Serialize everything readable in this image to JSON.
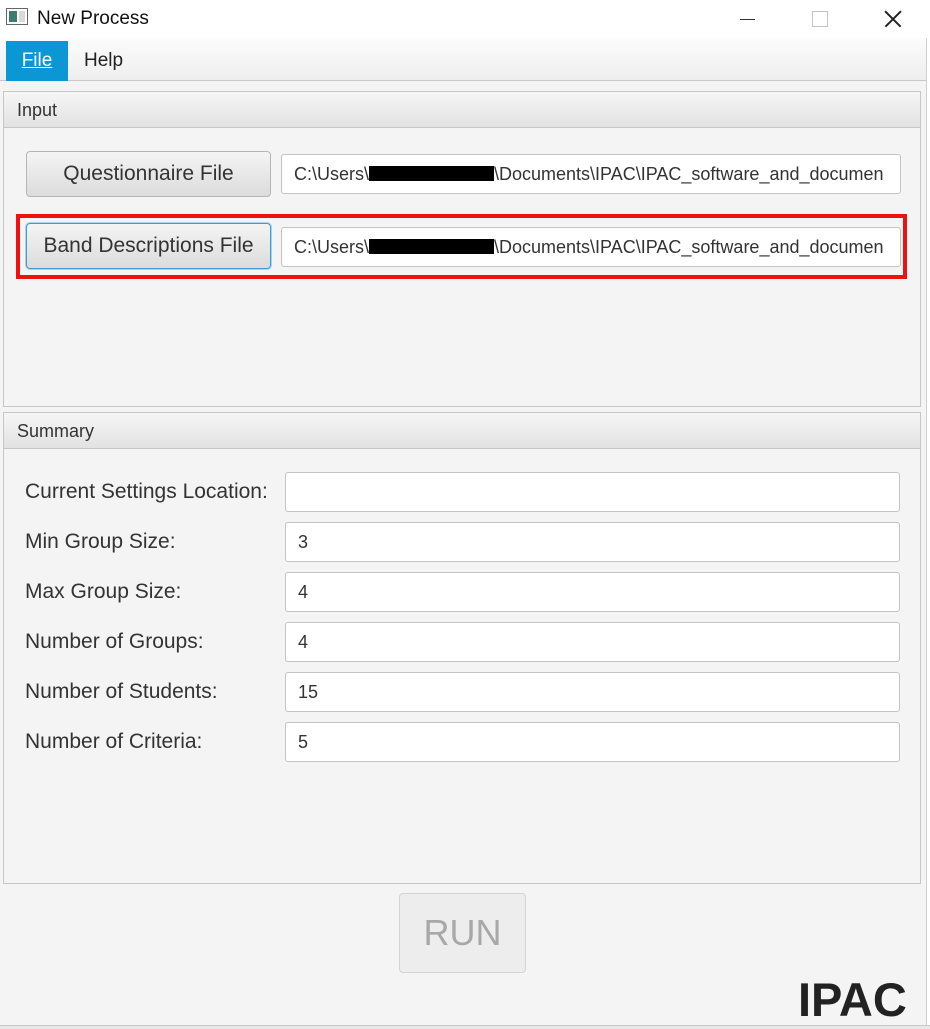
{
  "window": {
    "title": "New Process",
    "icon": "app-window-icon"
  },
  "menu": {
    "file_label": "File",
    "help_label": "Help"
  },
  "input_panel": {
    "header": "Input",
    "questionnaire_button": "Questionnaire File",
    "questionnaire_path_prefix": "C:\\Users\\",
    "questionnaire_path_suffix": "\\Documents\\IPAC\\IPAC_software_and_documen",
    "band_button": "Band Descriptions File",
    "band_path_prefix": "C:\\Users\\",
    "band_path_suffix": "\\Documents\\IPAC\\IPAC_software_and_documen"
  },
  "summary_panel": {
    "header": "Summary",
    "rows": [
      {
        "label": "Current Settings Location:",
        "value": ""
      },
      {
        "label": "Min Group Size:",
        "value": "3"
      },
      {
        "label": "Max Group Size:",
        "value": "4"
      },
      {
        "label": "Number of Groups:",
        "value": "4"
      },
      {
        "label": "Number of Students:",
        "value": "15"
      },
      {
        "label": "Number of Criteria:",
        "value": "5"
      }
    ]
  },
  "run_button": "RUN",
  "brand": "IPAC",
  "colors": {
    "menu_active": "#0b96d4",
    "highlight": "#e11111",
    "focus_border": "#3d9bd7"
  }
}
